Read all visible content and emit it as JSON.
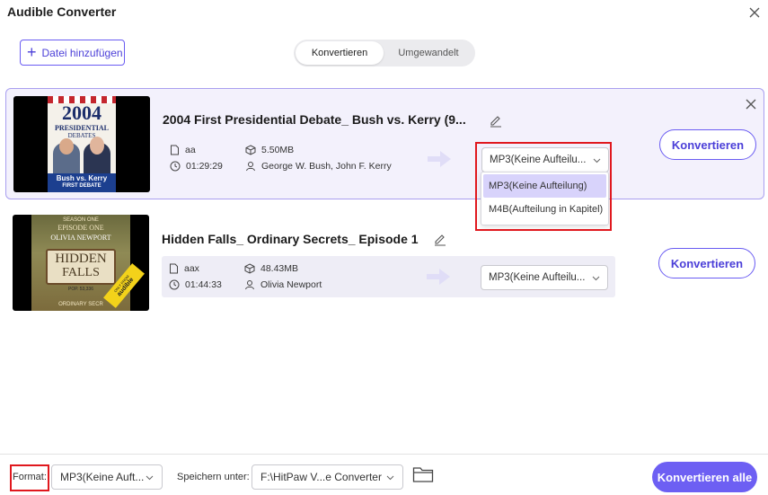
{
  "app": {
    "title": "Audible Converter"
  },
  "toolbar": {
    "add_file_label": "Datei hinzufügen"
  },
  "tabs": [
    {
      "label": "Konvertieren",
      "active": true
    },
    {
      "label": "Umgewandelt",
      "active": false
    }
  ],
  "items": [
    {
      "title": "2004 First Presidential Debate_ Bush vs. Kerry (9...",
      "format": "aa",
      "duration": "01:29:29",
      "size": "5.50MB",
      "authors": "George W. Bush, John F. Kerry",
      "output": "MP3(Keine Aufteilu...",
      "convert_label": "Konvertieren",
      "cover": {
        "year": "2004",
        "line1": "PRESIDENTIAL",
        "line2": "DEBATES",
        "caption1": "Bush vs. Kerry",
        "caption2": "FIRST DEBATE"
      }
    },
    {
      "title": "Hidden Falls_ Ordinary Secrets_ Episode 1",
      "format": "aax",
      "duration": "01:44:33",
      "size": "48.43MB",
      "authors": "Olivia Newport",
      "output": "MP3(Keine Aufteilu...",
      "convert_label": "Konvertieren",
      "cover": {
        "top1": "SEASON ONE",
        "top2": "EPISODE ONE",
        "author": "OLIVIA NEWPORT",
        "title1": "HIDDEN",
        "title2": "FALLS",
        "pop": "POP. 53,336",
        "bottom": "ORDINARY SECR",
        "badge1": "ONLY FROM",
        "badge2": "audible"
      }
    }
  ],
  "dropdown": {
    "options": [
      "MP3(Keine Aufteilung)",
      "M4B(Aufteilung in Kapitel)"
    ],
    "selected_index": 0
  },
  "footer": {
    "format_label": "Format:",
    "format_value": "MP3(Keine Auft...",
    "save_label": "Speichern unter:",
    "save_path": "F:\\HitPaw V...e Converter",
    "convert_all_label": "Konvertieren alle"
  },
  "colors": {
    "accent": "#6d5ff3",
    "highlight": "#e0181e",
    "selected_option": "#d8d3fb"
  },
  "icons": [
    "plus-icon",
    "close-icon",
    "edit-icon",
    "file-icon",
    "clock-icon",
    "box-icon",
    "user-icon",
    "arrow-right-icon",
    "chevron-down-icon",
    "folder-icon"
  ]
}
